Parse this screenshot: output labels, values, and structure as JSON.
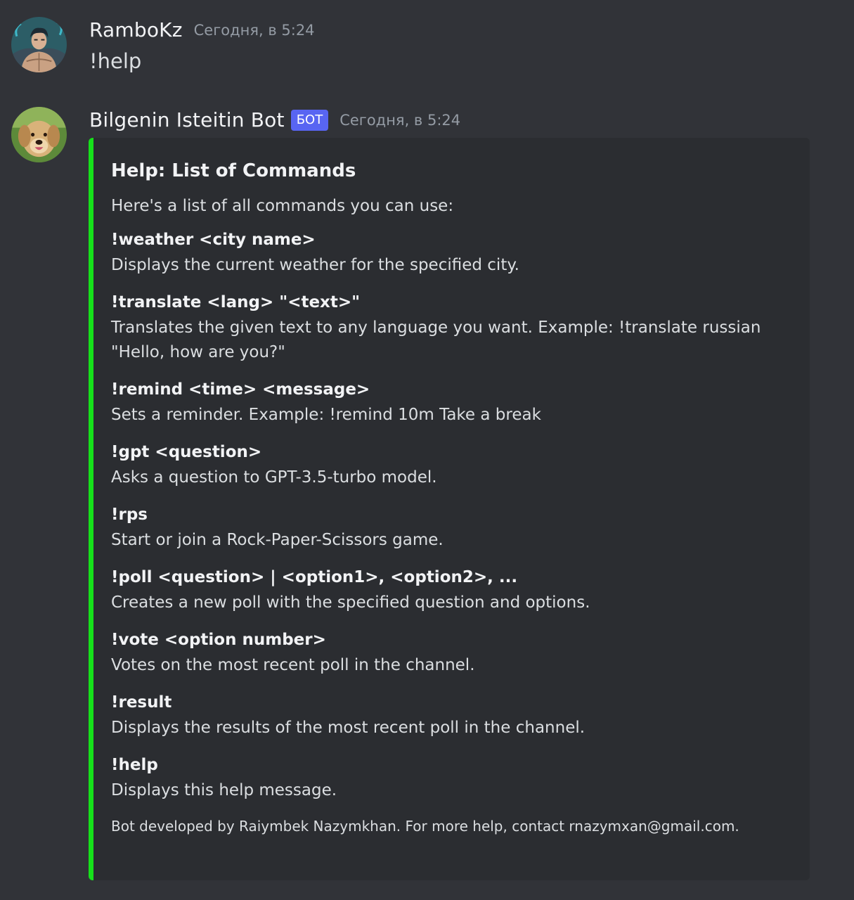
{
  "messages": [
    {
      "author": "RamboKz",
      "timestamp": "Сегодня, в 5:24",
      "content": "!help"
    },
    {
      "author": "Bilgenin Isteitin Bot",
      "bot_tag": "БОТ",
      "timestamp": "Сегодня, в 5:24",
      "embed": {
        "accent_color": "#16e11a",
        "title": "Help: List of Commands",
        "description": "Here's a list of all commands you can use:",
        "fields": [
          {
            "name": "!weather <city name>",
            "value": "Displays the current weather for the specified city."
          },
          {
            "name": "!translate <lang> \"<text>\"",
            "value": "Translates the given text to any language you want. Example: !translate russian \"Hello, how are you?\""
          },
          {
            "name": "!remind <time> <message>",
            "value": "Sets a reminder. Example: !remind 10m Take a break"
          },
          {
            "name": "!gpt <question>",
            "value": "Asks a question to GPT-3.5-turbo model."
          },
          {
            "name": "!rps",
            "value": "Start or join a Rock-Paper-Scissors game."
          },
          {
            "name": "!poll <question> | <option1>, <option2>, ...",
            "value": "Creates a new poll with the specified question and options."
          },
          {
            "name": "!vote <option number>",
            "value": "Votes on the most recent poll in the channel."
          },
          {
            "name": "!result",
            "value": "Displays the results of the most recent poll in the channel."
          },
          {
            "name": "!help",
            "value": "Displays this help message."
          }
        ],
        "footer": "Bot developed by Raiymbek Nazymkhan. For more help, contact rnazymxan@gmail.com."
      }
    }
  ],
  "colors": {
    "background": "#313338",
    "embed_background": "#2b2d31",
    "bot_tag": "#5865f2",
    "timestamp": "#949ba4"
  },
  "icons": {
    "user_avatar": "anime-muscular-man-avatar",
    "bot_avatar": "golden-retriever-dog-avatar"
  }
}
